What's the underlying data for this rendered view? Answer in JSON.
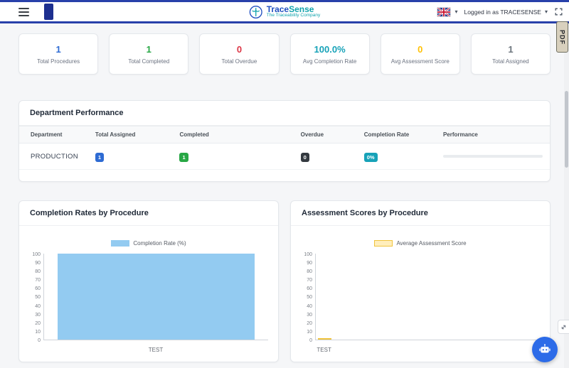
{
  "header": {
    "brand": {
      "name_primary": "Trace",
      "name_secondary": "Sense",
      "tagline": "The Traceability Company"
    },
    "user": {
      "logged_in_text": "Logged in as TRACESENSE"
    }
  },
  "pdf_tab": {
    "label": "PDF"
  },
  "stats": {
    "cards": [
      {
        "value": "1",
        "label": "Total Procedures",
        "color": "#2e6bd3"
      },
      {
        "value": "1",
        "label": "Total Completed",
        "color": "#28a745"
      },
      {
        "value": "0",
        "label": "Total Overdue",
        "color": "#dc3545"
      },
      {
        "value": "100.0%",
        "label": "Avg Completion Rate",
        "color": "#17a2b8"
      },
      {
        "value": "0",
        "label": "Avg Assessment Score",
        "color": "#ffc107"
      },
      {
        "value": "1",
        "label": "Total Assigned",
        "color": "#6c757d"
      }
    ]
  },
  "department": {
    "title": "Department Performance",
    "columns": [
      "Department",
      "Total Assigned",
      "Completed",
      "Overdue",
      "Completion Rate",
      "Performance"
    ],
    "badge_colors": {
      "assigned": "#2e6bd3",
      "completed": "#28a745",
      "overdue": "#343a40",
      "rate": "#17a2b8"
    },
    "rows": [
      {
        "department": "PRODUCTION",
        "total_assigned": "1",
        "completed": "1",
        "overdue": "0",
        "completion_rate": "0%",
        "performance_pct": 0
      }
    ]
  },
  "chart_data": [
    {
      "type": "bar",
      "title": "Completion Rates by Procedure",
      "legend": "Completion Rate (%)",
      "categories": [
        "TEST"
      ],
      "values": [
        100
      ],
      "xlabel": "",
      "ylabel": "",
      "ylim": [
        0,
        100
      ],
      "ytick_step": 10,
      "grid": false,
      "legend_position": "top",
      "fill": "#93cbf1",
      "border": "",
      "bar_left_pct": 6,
      "bar_width_pct": 88,
      "label_center_pct": 50
    },
    {
      "type": "bar",
      "title": "Assessment Scores by Procedure",
      "legend": "Average Assessment Score",
      "categories": [
        "TEST"
      ],
      "values": [
        0
      ],
      "xlabel": "",
      "ylabel": "",
      "ylim": [
        0,
        100
      ],
      "ytick_step": 10,
      "grid": false,
      "legend_position": "top",
      "fill": "#ffeebc",
      "border": "#f0c33c",
      "bar_left_pct": 1,
      "bar_width_pct": 6,
      "label_center_pct": 4
    }
  ]
}
